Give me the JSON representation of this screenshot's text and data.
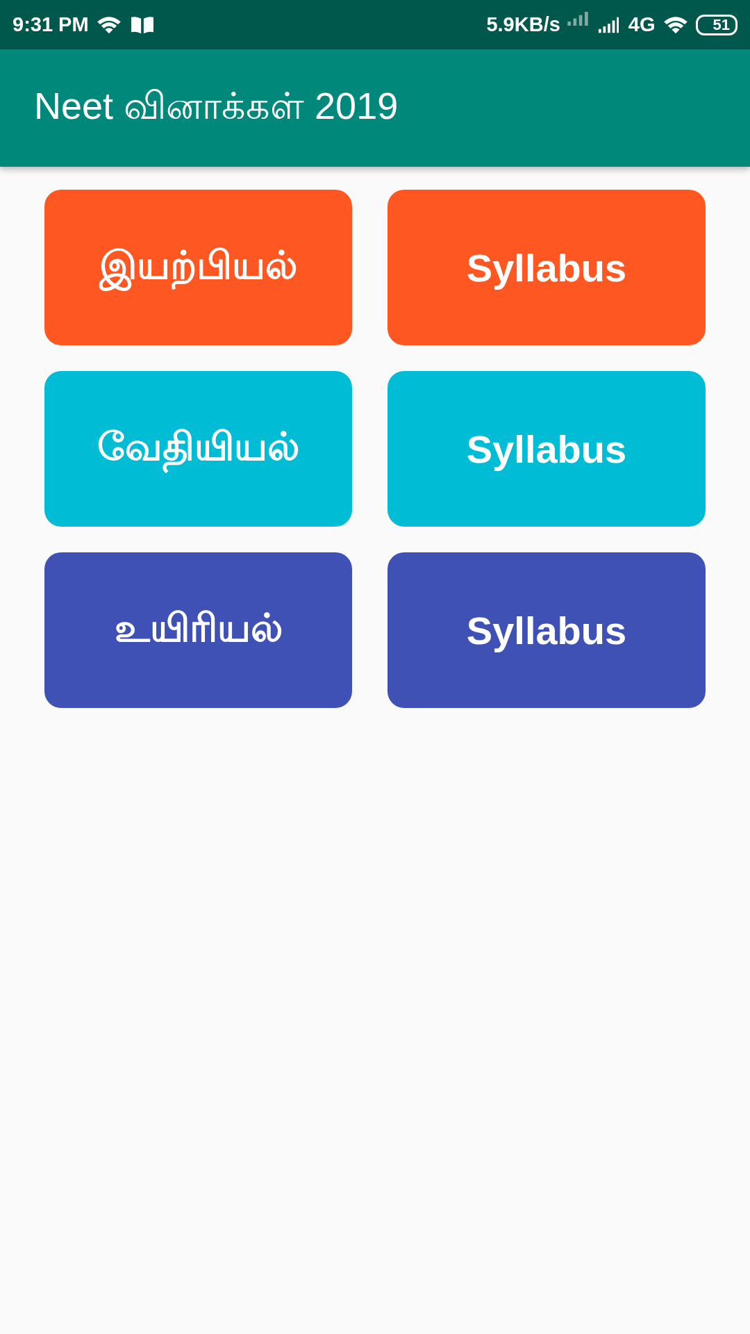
{
  "status_bar": {
    "time": "9:31 PM",
    "speed": "5.9KB/s",
    "network": "4G",
    "battery": "51"
  },
  "app_bar": {
    "title": "Neet வினாக்கள் 2019"
  },
  "buttons": [
    {
      "label": "இயற்பியல்",
      "color": "#ff5722"
    },
    {
      "label": "Syllabus",
      "color": "#ff5722"
    },
    {
      "label": "வேதியியல்",
      "color": "#00bcd4"
    },
    {
      "label": "Syllabus",
      "color": "#00bcd4"
    },
    {
      "label": "உயிரியல்",
      "color": "#3f51b5"
    },
    {
      "label": "Syllabus",
      "color": "#3f51b5"
    }
  ]
}
